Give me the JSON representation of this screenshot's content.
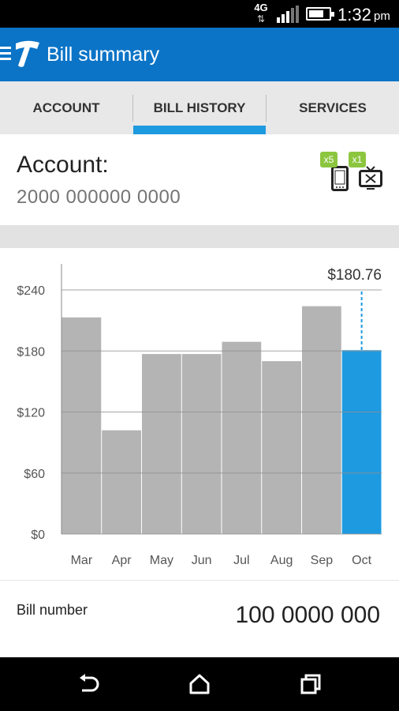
{
  "status_bar": {
    "network": "4G",
    "network_arrows": "⇅",
    "time": "1:32",
    "ampm": "pm"
  },
  "app_bar": {
    "title": "Bill summary",
    "icons": [
      "menu-icon",
      "telstra-logo-icon"
    ]
  },
  "tabs": [
    {
      "label": "ACCOUNT",
      "selected": false
    },
    {
      "label": "BILL HISTORY",
      "selected": true
    },
    {
      "label": "SERVICES",
      "selected": false
    }
  ],
  "account": {
    "heading": "Account:",
    "number": "2000 000000 0000",
    "devices": [
      {
        "icon": "mobile-phone-icon",
        "badge": "x5"
      },
      {
        "icon": "broadband-tv-icon",
        "badge": "x1"
      }
    ]
  },
  "chart_data": {
    "type": "bar",
    "categories": [
      "Mar",
      "Apr",
      "May",
      "Jun",
      "Jul",
      "Aug",
      "Sep",
      "Oct"
    ],
    "values": [
      213,
      102,
      177,
      177,
      189,
      170,
      224,
      180.76
    ],
    "highlighted_index": 7,
    "highlight_label": "$180.76",
    "ylim": [
      0,
      240
    ],
    "y_ticks": [
      "$0",
      "$60",
      "$120",
      "$180",
      "$240"
    ],
    "y_tick_values": [
      0,
      60,
      120,
      180,
      240
    ],
    "grid": true,
    "colors": {
      "bar": "#b4b4b4",
      "highlight": "#1e9ae0",
      "grid": "#909090"
    }
  },
  "bill": {
    "label": "Bill number",
    "value": "100 0000 000"
  },
  "nav_bar": {
    "icons": [
      "back-icon",
      "home-icon",
      "recent-apps-icon"
    ]
  },
  "colors": {
    "app_bar": "#0b74c7",
    "accent": "#1e9ae0",
    "badge": "#8cc63f"
  }
}
